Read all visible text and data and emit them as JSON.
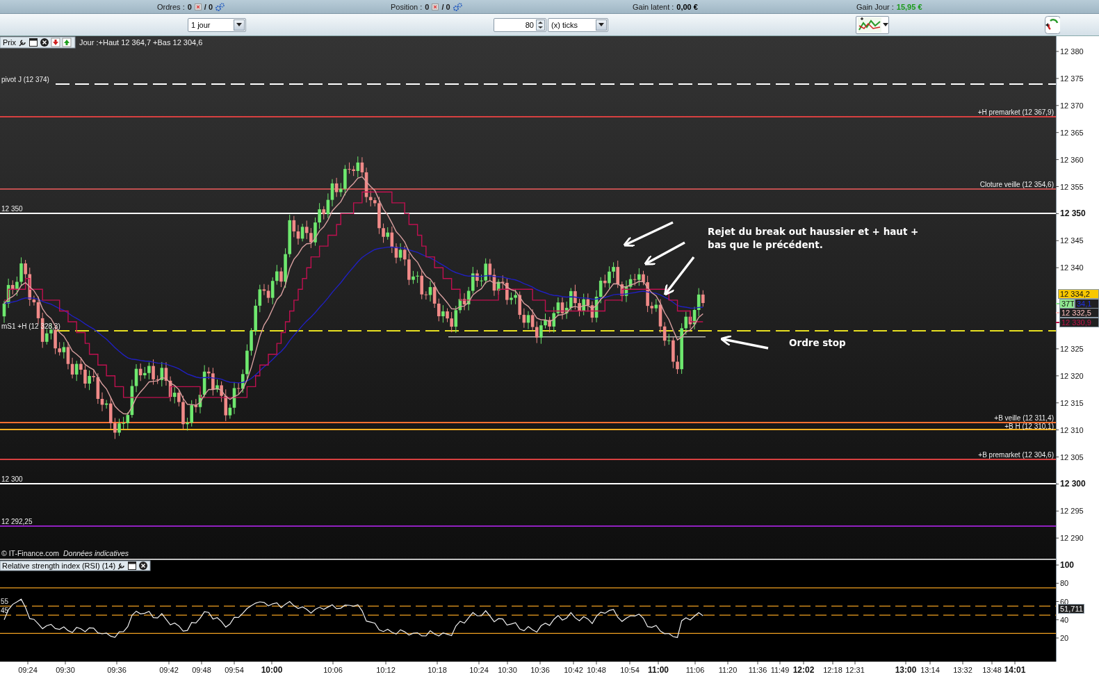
{
  "status_bar": {
    "items": [
      {
        "label": "Ordres :",
        "value": "0",
        "extra": "/ 0",
        "kind": "orders"
      },
      {
        "label": "Position :",
        "value": "0",
        "extra": "/ 0",
        "kind": "orders"
      },
      {
        "label": "Gain latent :",
        "value": "0,00 €",
        "kind": "money",
        "color": "#000000"
      },
      {
        "label": "Gain Jour :",
        "value": "15,95 €",
        "kind": "money",
        "color": "#1a9a1a"
      }
    ]
  },
  "toolbar": {
    "period": "1 jour",
    "tick_count": "80",
    "tick_unit": "(x) ticks"
  },
  "price_panel": {
    "tab": "Prix",
    "header": "Jour :+Haut 12 364,7 +Bas 12 304,6",
    "levels": [
      {
        "label": "pivot J (12 374)",
        "color": "#ffffff"
      },
      {
        "label": "+H premarket (12 367,9)",
        "color": "#d84040"
      },
      {
        "label": "Cloture veille (12 354,6)",
        "color": "#c05050"
      },
      {
        "label": "12 350",
        "color": "#ffffff"
      },
      {
        "label": "mS1 +H (12 328,3)",
        "color": "#e8e020"
      },
      {
        "label": "+B veille (12 311,4)",
        "color": "#ff7030"
      },
      {
        "label": "+B H (12 310,1)",
        "color": "#ffb020"
      },
      {
        "label": "+B premarket (12 304,6)",
        "color": "#d84040"
      },
      {
        "label": "12 300",
        "color": "#ffffff"
      },
      {
        "label": "12 292,25",
        "color": "#9020c0"
      }
    ],
    "y_ticks": [
      {
        "label": "12 380",
        "major": false
      },
      {
        "label": "12 375",
        "major": false
      },
      {
        "label": "12 370",
        "major": false
      },
      {
        "label": "12 365",
        "major": false
      },
      {
        "label": "12 360",
        "major": false
      },
      {
        "label": "12 355",
        "major": false
      },
      {
        "label": "12 350",
        "major": true
      },
      {
        "label": "12 345",
        "major": false
      },
      {
        "label": "12 340",
        "major": false
      },
      {
        "label": "12 325",
        "major": false
      },
      {
        "label": "12 320",
        "major": false
      },
      {
        "label": "12 315",
        "major": false
      },
      {
        "label": "12 310",
        "major": false
      },
      {
        "label": "12 305",
        "major": false
      },
      {
        "label": "12 300",
        "major": true
      },
      {
        "label": "12 295",
        "major": false
      },
      {
        "label": "12 290",
        "major": false
      }
    ],
    "price_badges": [
      {
        "text": "12 334,2",
        "color": "#f8c800"
      },
      {
        "text": "37T",
        "extra": "34,1",
        "color": "#90e890"
      },
      {
        "text": "12 332,5",
        "color": "#ffc0c0"
      },
      {
        "text": "12 330,9",
        "color": "#c0104a"
      }
    ],
    "annotations": [
      {
        "kind": "text",
        "text": "Rejet du break out haussier et + haut + bas que le précédent."
      },
      {
        "kind": "arrow"
      },
      {
        "kind": "arrow"
      },
      {
        "kind": "arrow"
      },
      {
        "kind": "arrow"
      },
      {
        "kind": "text",
        "text": "Ordre stop"
      }
    ],
    "copyright": "© IT-Finance.com",
    "disclaimer": "Données indicatives"
  },
  "rsi_panel": {
    "title": "Relative strength index (RSI) (14)",
    "y_ticks": [
      "100",
      "80",
      "60",
      "40",
      "20"
    ],
    "level_labels": [
      "55",
      "45"
    ],
    "value_badge": "51,711"
  },
  "x_axis": [
    {
      "label": "09:24",
      "major": false
    },
    {
      "label": "09:30",
      "major": false
    },
    {
      "label": "09:36",
      "major": false
    },
    {
      "label": "09:42",
      "major": false
    },
    {
      "label": "09:48",
      "major": false
    },
    {
      "label": "09:54",
      "major": false
    },
    {
      "label": "10:00",
      "major": true
    },
    {
      "label": "10:06",
      "major": false
    },
    {
      "label": "10:12",
      "major": false
    },
    {
      "label": "10:18",
      "major": false
    },
    {
      "label": "10:24",
      "major": false
    },
    {
      "label": "10:30",
      "major": false
    },
    {
      "label": "10:36",
      "major": false
    },
    {
      "label": "10:42",
      "major": false
    },
    {
      "label": "10:48",
      "major": false
    },
    {
      "label": "10:54",
      "major": false
    },
    {
      "label": "11:00",
      "major": true
    },
    {
      "label": "11:06",
      "major": false
    },
    {
      "label": "11:20",
      "major": false
    },
    {
      "label": "11:36",
      "major": false
    },
    {
      "label": "11:49",
      "major": false
    },
    {
      "label": "12:02",
      "major": true
    },
    {
      "label": "12:18",
      "major": false
    },
    {
      "label": "12:31",
      "major": false
    },
    {
      "label": "13:00",
      "major": true
    },
    {
      "label": "13:14",
      "major": false
    },
    {
      "label": "13:32",
      "major": false
    },
    {
      "label": "13:48",
      "major": false
    },
    {
      "label": "14:01",
      "major": true
    }
  ]
}
